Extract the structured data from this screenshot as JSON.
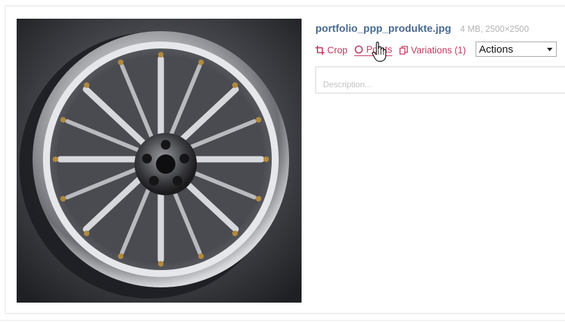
{
  "file": {
    "name": "portfolio_ppp_produkte.jpg",
    "meta": "4 MB, 2500×2500"
  },
  "actions": {
    "crop_label": "Crop",
    "points_label": "Points",
    "variations_label": "Variations (1)",
    "menu_selected": "Actions"
  },
  "description": {
    "placeholder": "Description...",
    "value": ""
  },
  "thumbnail": {
    "subject": "alloy wheel rim"
  },
  "icons": {
    "crop": "crop-icon",
    "points": "circle-icon",
    "variations": "copy-icon",
    "cursor": "hand-pointer-icon"
  },
  "colors": {
    "link": "#c0385e",
    "filename": "#4a6a8e",
    "meta": "#b4b4b4",
    "border": "#e3e3e3"
  }
}
